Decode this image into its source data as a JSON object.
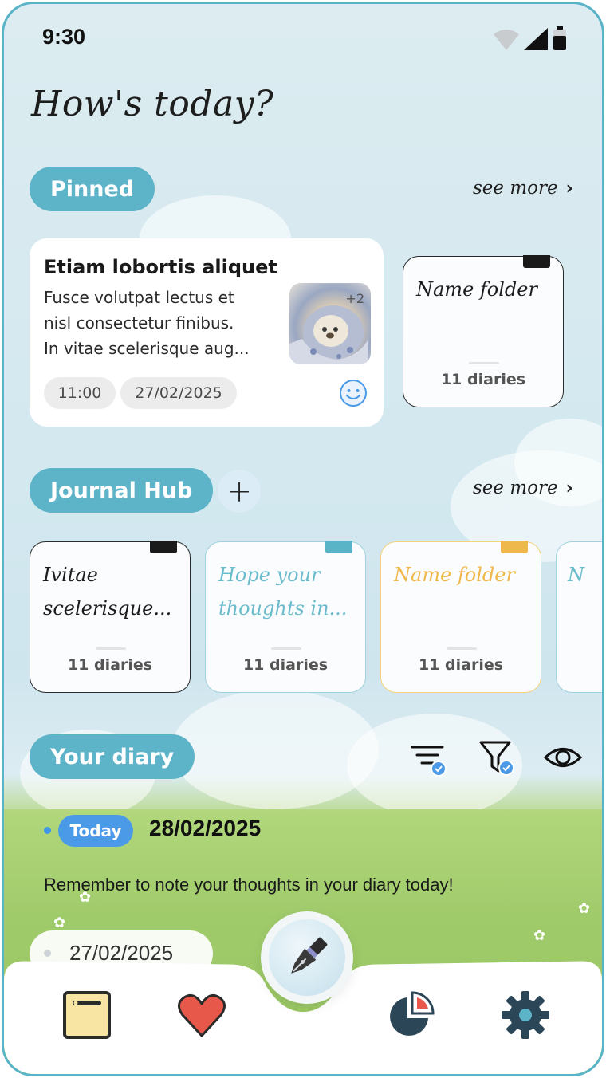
{
  "status_bar": {
    "time": "9:30"
  },
  "greeting": "How's today?",
  "pinned": {
    "label": "Pinned",
    "see_more": "see more",
    "entry": {
      "title": "Etiam lobortis aliquet",
      "lines": [
        "Fusce volutpat lectus et",
        "nisl consectetur finibus.",
        "In vitae scelerisque aug..."
      ],
      "extra_images": "+2",
      "time": "11:00",
      "date": "27/02/2025"
    },
    "folder": {
      "name": "Name folder",
      "count": "11 diaries",
      "tab_color": "#1a1a1a"
    }
  },
  "journal_hub": {
    "label": "Journal Hub",
    "add_label": "+",
    "see_more": "see more",
    "folders": [
      {
        "name_line1": "Ivitae",
        "name_line2": "scelerisque...",
        "count": "11 diaries",
        "color": "#2a2a2a",
        "text_color": "#1d1d1d",
        "tab_color": "#1a1a1a"
      },
      {
        "name_line1": "Hope your",
        "name_line2": "thoughts in...",
        "count": "11 diaries",
        "color": "#9fd2de",
        "text_color": "#6bbccd",
        "tab_color": "#5ab4c8"
      },
      {
        "name_line1": "Name folder",
        "name_line2": "",
        "count": "11 diaries",
        "color": "#f3d27a",
        "text_color": "#efb84a",
        "tab_color": "#efb84a"
      },
      {
        "name_line1": "N",
        "name_line2": "",
        "count": "",
        "color": "#9fd2de",
        "text_color": "#6bbccd",
        "tab_color": "#5ab4c8"
      }
    ]
  },
  "your_diary": {
    "label": "Your diary",
    "today_badge": "Today",
    "today_date": "28/02/2025",
    "reminder": "Remember to note your thoughts in your diary today!",
    "previous_date": "27/02/2025"
  },
  "bottom_nav": {
    "items": [
      "diary-icon",
      "heart-icon",
      "pen-icon",
      "chart-icon",
      "gear-icon"
    ]
  },
  "colors": {
    "accent": "#5db4c9",
    "today": "#4a9ae8",
    "heart": "#e8584a",
    "nav_dark": "#2b4656"
  }
}
